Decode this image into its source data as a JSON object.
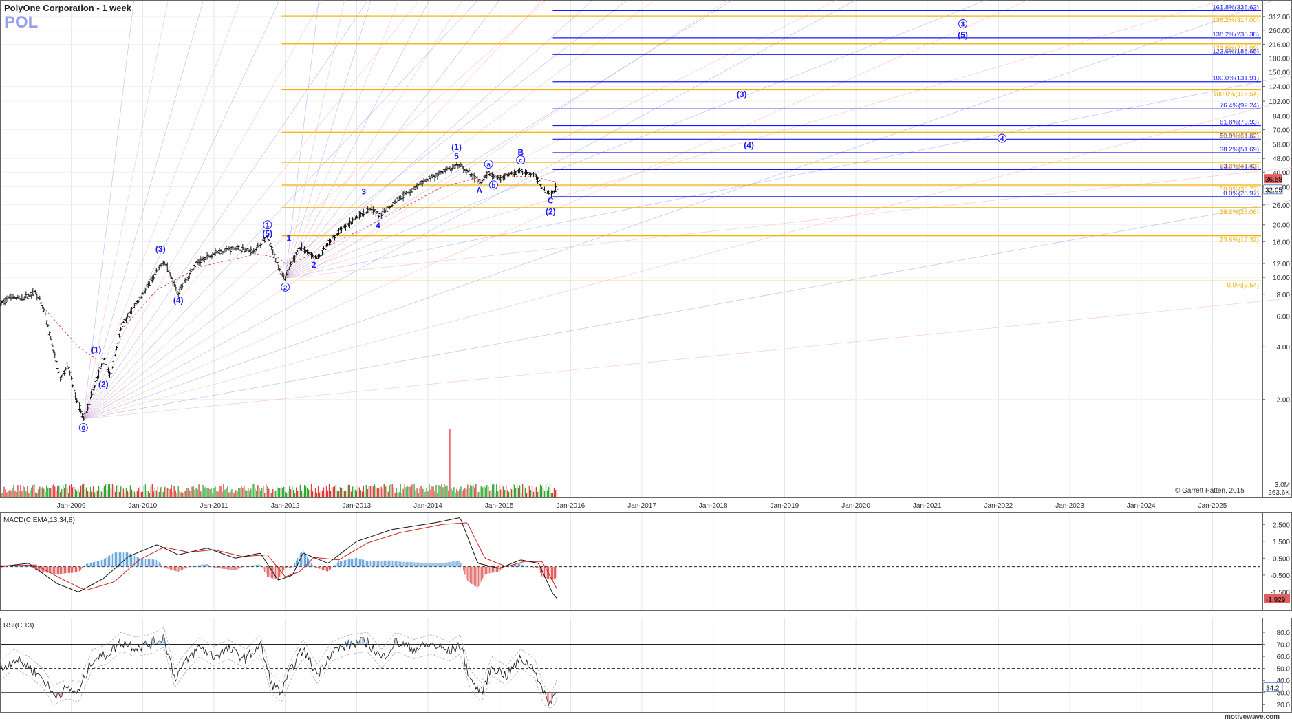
{
  "header": {
    "title": "PolyOne Corporation - 1 week",
    "symbol": "POL",
    "copyright": "© Garrett Patten, 2015",
    "brand": "motivewave.com"
  },
  "colors": {
    "blue": "#1a1aff",
    "orange": "#f0b000",
    "bar": "#111111",
    "vol_up": "#2fa82f",
    "vol_down": "#e03a3a",
    "macd": "#111111",
    "signal": "#d02020",
    "hist_pos": "#6fa8dc",
    "hist_neg": "#e06060",
    "grid": "#e6e6e6",
    "fan_blue": "#8c8cff",
    "fan_red": "#ff9c9c",
    "price_tag_up": "#e06060",
    "price_tag_low": "#5b82d9"
  },
  "chart_data": [
    {
      "type": "ohlc",
      "title": "PolyOne Corporation - 1 week",
      "symbol": "POL",
      "scale": "log",
      "ylim": [
        1.4,
        360
      ],
      "x_ticks": [
        "Jan-2009",
        "Jan-2010",
        "Jan-2011",
        "Jan-2012",
        "Jan-2013",
        "Jan-2014",
        "Jan-2015",
        "Jan-2016",
        "Jan-2017",
        "Jan-2018",
        "Jan-2019",
        "Jan-2020",
        "Jan-2021",
        "Jan-2022",
        "Jan-2023",
        "Jan-2024",
        "Jan-2025"
      ],
      "x_tick_years": [
        2009,
        2010,
        2011,
        2012,
        2013,
        2014,
        2015,
        2016,
        2017,
        2018,
        2019,
        2020,
        2021,
        2022,
        2023,
        2024,
        2025
      ],
      "y_ticks": [
        "312.00",
        "260.00",
        "216.00",
        "180.00",
        "150.00",
        "124.00",
        "102.00",
        "84.00",
        "70.00",
        "58.00",
        "48.00",
        "40.00",
        "33.00",
        "26.00",
        "20.00",
        "16.00",
        "12.00",
        "10.00",
        "8.00",
        "6.00",
        "4.00",
        "2.00"
      ],
      "y_tick_values": [
        312,
        260,
        216,
        180,
        150,
        124,
        102,
        84,
        70,
        58,
        48,
        40,
        33,
        26,
        20,
        16,
        12,
        10,
        8,
        6,
        4,
        2
      ],
      "last_price": "36.58",
      "second_price": "32.05",
      "price_path": [
        {
          "t": 2008.0,
          "v": 7.0
        },
        {
          "t": 2008.15,
          "v": 7.8
        },
        {
          "t": 2008.3,
          "v": 7.5
        },
        {
          "t": 2008.5,
          "v": 8.3
        },
        {
          "t": 2008.62,
          "v": 6.4
        },
        {
          "t": 2008.75,
          "v": 3.8
        },
        {
          "t": 2008.85,
          "v": 2.6
        },
        {
          "t": 2008.95,
          "v": 3.2
        },
        {
          "t": 2009.04,
          "v": 2.2
        },
        {
          "t": 2009.17,
          "v": 1.55
        },
        {
          "t": 2009.3,
          "v": 2.2
        },
        {
          "t": 2009.45,
          "v": 3.4
        },
        {
          "t": 2009.55,
          "v": 2.7
        },
        {
          "t": 2009.7,
          "v": 5.2
        },
        {
          "t": 2009.9,
          "v": 7.0
        },
        {
          "t": 2010.05,
          "v": 8.6
        },
        {
          "t": 2010.3,
          "v": 12.5
        },
        {
          "t": 2010.5,
          "v": 8.2
        },
        {
          "t": 2010.75,
          "v": 12.0
        },
        {
          "t": 2011.0,
          "v": 13.8
        },
        {
          "t": 2011.3,
          "v": 14.8
        },
        {
          "t": 2011.55,
          "v": 14.0
        },
        {
          "t": 2011.75,
          "v": 17.0
        },
        {
          "t": 2011.9,
          "v": 11.5
        },
        {
          "t": 2012.0,
          "v": 9.9
        },
        {
          "t": 2012.2,
          "v": 15.0
        },
        {
          "t": 2012.45,
          "v": 12.8
        },
        {
          "t": 2012.7,
          "v": 17.5
        },
        {
          "t": 2013.0,
          "v": 22.0
        },
        {
          "t": 2013.2,
          "v": 25.0
        },
        {
          "t": 2013.32,
          "v": 22.5
        },
        {
          "t": 2013.6,
          "v": 28.5
        },
        {
          "t": 2014.0,
          "v": 36.5
        },
        {
          "t": 2014.25,
          "v": 41.0
        },
        {
          "t": 2014.45,
          "v": 43.5
        },
        {
          "t": 2014.75,
          "v": 34.8
        },
        {
          "t": 2014.85,
          "v": 39.5
        },
        {
          "t": 2015.0,
          "v": 37.0
        },
        {
          "t": 2015.3,
          "v": 40.5
        },
        {
          "t": 2015.5,
          "v": 38.5
        },
        {
          "t": 2015.62,
          "v": 32.0
        },
        {
          "t": 2015.72,
          "v": 30.0
        },
        {
          "t": 2015.82,
          "v": 33.2
        }
      ],
      "wave_labels": [
        {
          "text": "0",
          "t": 2009.17,
          "v": 1.38,
          "circled": true
        },
        {
          "text": "(1)",
          "t": 2009.35,
          "v": 3.85,
          "circled": false
        },
        {
          "text": "(2)",
          "t": 2009.45,
          "v": 2.45,
          "circled": false
        },
        {
          "text": "(3)",
          "t": 2010.25,
          "v": 14.5,
          "circled": false
        },
        {
          "text": "(4)",
          "t": 2010.5,
          "v": 7.4,
          "circled": false
        },
        {
          "text": "1",
          "t": 2011.75,
          "v": 20.0,
          "circled": true
        },
        {
          "text": "(5)",
          "t": 2011.75,
          "v": 17.8,
          "circled": false
        },
        {
          "text": "2",
          "t": 2012.0,
          "v": 8.8,
          "circled": true
        },
        {
          "text": "1",
          "t": 2012.05,
          "v": 16.8,
          "circled": false
        },
        {
          "text": "2",
          "t": 2012.4,
          "v": 11.8,
          "circled": false
        },
        {
          "text": "3",
          "t": 2013.1,
          "v": 31.0,
          "circled": false
        },
        {
          "text": "4",
          "t": 2013.3,
          "v": 19.8,
          "circled": false
        },
        {
          "text": "5",
          "t": 2014.4,
          "v": 49.5,
          "circled": false
        },
        {
          "text": "(1)",
          "t": 2014.4,
          "v": 55.5,
          "circled": false
        },
        {
          "text": "a",
          "t": 2014.85,
          "v": 44.5,
          "circled": true
        },
        {
          "text": "A",
          "t": 2014.72,
          "v": 31.5,
          "circled": false
        },
        {
          "text": "b",
          "t": 2014.92,
          "v": 33.8,
          "circled": true
        },
        {
          "text": "B",
          "t": 2015.3,
          "v": 52.0,
          "circled": false
        },
        {
          "text": "c",
          "t": 2015.3,
          "v": 47.0,
          "circled": true
        },
        {
          "text": "C",
          "t": 2015.72,
          "v": 27.5,
          "circled": false
        },
        {
          "text": "(2)",
          "t": 2015.72,
          "v": 23.8,
          "circled": false
        },
        {
          "text": "(4)",
          "t": 2018.5,
          "v": 57.0,
          "circled": false
        },
        {
          "text": "(3)",
          "t": 2018.4,
          "v": 112.0,
          "circled": false
        },
        {
          "text": "4",
          "t": 2022.05,
          "v": 62.5,
          "circled": true
        },
        {
          "text": "3",
          "t": 2021.5,
          "v": 283.0,
          "circled": true
        },
        {
          "text": "(5)",
          "t": 2021.5,
          "v": 244.0,
          "circled": false
        }
      ],
      "fib_blue": [
        {
          "label": "161.8%(336.62)",
          "value": 336.62
        },
        {
          "label": "138.2%(235.38)",
          "value": 235.38
        },
        {
          "label": "123.6%(188.65)",
          "value": 188.65
        },
        {
          "label": "100.0%(131.91)",
          "value": 131.91
        },
        {
          "label": "76.4%(92.24)",
          "value": 92.24
        },
        {
          "label": "61.8%(73.93)",
          "value": 73.93
        },
        {
          "label": "50.0%(61.82)",
          "value": 61.82
        },
        {
          "label": "38.2%(51.69)",
          "value": 51.69
        },
        {
          "label": "23.6%(41.43)",
          "value": 41.43
        },
        {
          "label": "0.0%(28.97)",
          "value": 28.97
        }
      ],
      "fib_orange": [
        {
          "label": "138.2%(314.00)",
          "value": 314.0
        },
        {
          "label": "123.6%(217.09)",
          "value": 217.09
        },
        {
          "label": "100.0%(118.54)",
          "value": 118.54
        },
        {
          "label": "76.4%(67.72)",
          "value": 67.72
        },
        {
          "label": "61.8%(45.51)",
          "value": 45.51
        },
        {
          "label": "50.0%(33.77)",
          "value": 33.77
        },
        {
          "label": "38.2%(25.06)",
          "value": 25.06
        },
        {
          "label": "23.6%(17.32)",
          "value": 17.32
        },
        {
          "label": "0.0%(9.54)",
          "value": 9.54
        }
      ],
      "volume_labels": [
        "3.0M",
        "263.6K"
      ]
    },
    {
      "type": "line",
      "title": "MACD(C,EMA,13,34,8)",
      "y_ticks": [
        "2.500",
        "1.500",
        "0.500",
        "-0.500",
        "-1.500"
      ],
      "y_tick_values": [
        2.5,
        1.5,
        0.5,
        -0.5,
        -1.5
      ],
      "ylim": [
        -2.5,
        3.0
      ],
      "last_value": "-1.929",
      "macd_path": [
        {
          "t": 2008.0,
          "v": 0.0
        },
        {
          "t": 2008.4,
          "v": 0.2
        },
        {
          "t": 2008.8,
          "v": -1.0
        },
        {
          "t": 2009.1,
          "v": -1.5
        },
        {
          "t": 2009.45,
          "v": -0.7
        },
        {
          "t": 2009.8,
          "v": 0.6
        },
        {
          "t": 2010.2,
          "v": 1.3
        },
        {
          "t": 2010.5,
          "v": 0.7
        },
        {
          "t": 2010.9,
          "v": 1.1
        },
        {
          "t": 2011.3,
          "v": 0.5
        },
        {
          "t": 2011.65,
          "v": 0.8
        },
        {
          "t": 2011.9,
          "v": -0.8
        },
        {
          "t": 2012.1,
          "v": -0.5
        },
        {
          "t": 2012.25,
          "v": 0.8
        },
        {
          "t": 2012.6,
          "v": 0.2
        },
        {
          "t": 2013.0,
          "v": 1.5
        },
        {
          "t": 2013.5,
          "v": 2.2
        },
        {
          "t": 2014.1,
          "v": 2.6
        },
        {
          "t": 2014.45,
          "v": 2.9
        },
        {
          "t": 2014.7,
          "v": 0.2
        },
        {
          "t": 2015.0,
          "v": -0.1
        },
        {
          "t": 2015.3,
          "v": 0.4
        },
        {
          "t": 2015.55,
          "v": 0.2
        },
        {
          "t": 2015.75,
          "v": -1.6
        },
        {
          "t": 2015.82,
          "v": -1.93
        }
      ],
      "signal_path": [
        {
          "t": 2008.0,
          "v": 0.05
        },
        {
          "t": 2008.5,
          "v": 0.1
        },
        {
          "t": 2008.9,
          "v": -0.8
        },
        {
          "t": 2009.2,
          "v": -1.4
        },
        {
          "t": 2009.6,
          "v": -0.9
        },
        {
          "t": 2009.95,
          "v": 0.4
        },
        {
          "t": 2010.3,
          "v": 1.15
        },
        {
          "t": 2010.65,
          "v": 0.85
        },
        {
          "t": 2011.0,
          "v": 1.0
        },
        {
          "t": 2011.4,
          "v": 0.6
        },
        {
          "t": 2011.75,
          "v": 0.7
        },
        {
          "t": 2012.0,
          "v": -0.6
        },
        {
          "t": 2012.2,
          "v": -0.3
        },
        {
          "t": 2012.4,
          "v": 0.55
        },
        {
          "t": 2012.75,
          "v": 0.4
        },
        {
          "t": 2013.15,
          "v": 1.4
        },
        {
          "t": 2013.6,
          "v": 2.0
        },
        {
          "t": 2014.2,
          "v": 2.5
        },
        {
          "t": 2014.55,
          "v": 2.6
        },
        {
          "t": 2014.8,
          "v": 0.5
        },
        {
          "t": 2015.1,
          "v": 0.0
        },
        {
          "t": 2015.35,
          "v": 0.3
        },
        {
          "t": 2015.6,
          "v": 0.3
        },
        {
          "t": 2015.82,
          "v": -1.4
        }
      ]
    },
    {
      "type": "line",
      "title": "RSI(C,13)",
      "y_ticks": [
        "80.0",
        "70.0",
        "60.0",
        "50.0",
        "40.0",
        "30.0",
        "20.0"
      ],
      "y_tick_values": [
        80,
        70,
        60,
        50,
        40,
        30,
        20
      ],
      "ylim": [
        15,
        88
      ],
      "last_value": "34.2",
      "rsi_path": [
        {
          "t": 2008.0,
          "v": 48
        },
        {
          "t": 2008.2,
          "v": 58
        },
        {
          "t": 2008.4,
          "v": 52
        },
        {
          "t": 2008.6,
          "v": 42
        },
        {
          "t": 2008.75,
          "v": 28
        },
        {
          "t": 2008.95,
          "v": 33
        },
        {
          "t": 2009.1,
          "v": 30
        },
        {
          "t": 2009.3,
          "v": 58
        },
        {
          "t": 2009.5,
          "v": 62
        },
        {
          "t": 2009.7,
          "v": 72
        },
        {
          "t": 2009.9,
          "v": 68
        },
        {
          "t": 2010.1,
          "v": 70
        },
        {
          "t": 2010.3,
          "v": 76
        },
        {
          "t": 2010.45,
          "v": 42
        },
        {
          "t": 2010.6,
          "v": 55
        },
        {
          "t": 2010.8,
          "v": 68
        },
        {
          "t": 2011.0,
          "v": 60
        },
        {
          "t": 2011.2,
          "v": 66
        },
        {
          "t": 2011.45,
          "v": 58
        },
        {
          "t": 2011.65,
          "v": 70
        },
        {
          "t": 2011.8,
          "v": 38
        },
        {
          "t": 2011.95,
          "v": 30
        },
        {
          "t": 2012.1,
          "v": 52
        },
        {
          "t": 2012.25,
          "v": 66
        },
        {
          "t": 2012.45,
          "v": 45
        },
        {
          "t": 2012.65,
          "v": 64
        },
        {
          "t": 2012.9,
          "v": 70
        },
        {
          "t": 2013.15,
          "v": 72
        },
        {
          "t": 2013.35,
          "v": 58
        },
        {
          "t": 2013.55,
          "v": 72
        },
        {
          "t": 2013.8,
          "v": 66
        },
        {
          "t": 2014.05,
          "v": 70
        },
        {
          "t": 2014.3,
          "v": 64
        },
        {
          "t": 2014.45,
          "v": 70
        },
        {
          "t": 2014.6,
          "v": 40
        },
        {
          "t": 2014.75,
          "v": 30
        },
        {
          "t": 2014.9,
          "v": 52
        },
        {
          "t": 2015.1,
          "v": 44
        },
        {
          "t": 2015.3,
          "v": 58
        },
        {
          "t": 2015.5,
          "v": 50
        },
        {
          "t": 2015.62,
          "v": 28
        },
        {
          "t": 2015.72,
          "v": 22
        },
        {
          "t": 2015.8,
          "v": 30
        },
        {
          "t": 2015.82,
          "v": 42
        }
      ],
      "levels": [
        70,
        50,
        30
      ]
    }
  ]
}
